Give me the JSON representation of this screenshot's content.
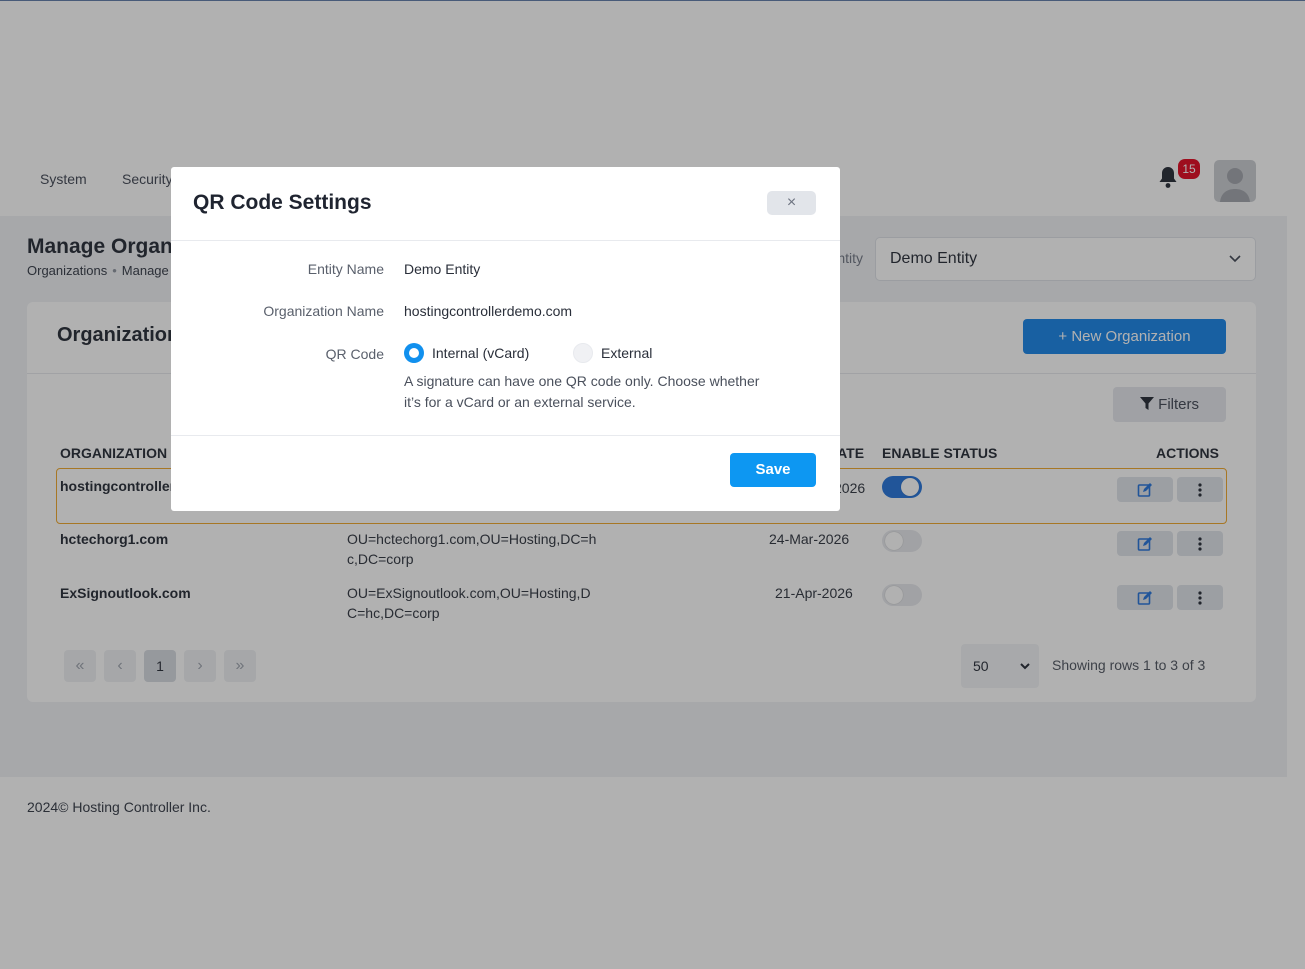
{
  "nav": {
    "items": [
      "System",
      "Security"
    ],
    "notifications": "15"
  },
  "page": {
    "title": "Manage Organizations",
    "breadcrumb": [
      "Organizations",
      "Manage"
    ],
    "entity_label": "Entity",
    "entity_selected": "Demo Entity"
  },
  "card": {
    "title": "Organizations",
    "new_button": "+ New Organization",
    "filters_button": "Filters",
    "columns": [
      "ORGANIZATION",
      "DATE",
      "ENABLE STATUS",
      "ACTIONS"
    ],
    "rows": [
      {
        "name": "hostingcontrollerdemo.com",
        "dn": "",
        "date": "2026",
        "enabled": true
      },
      {
        "name": "hctechorg1.com",
        "dn_line1": "OU=hctechorg1.com,OU=Hosting,DC=h",
        "dn_line2": "c,DC=corp",
        "date": "24-Mar-2026",
        "enabled": false
      },
      {
        "name": "ExSignoutlook.com",
        "dn_line1": "OU=ExSignoutlook.com,OU=Hosting,D",
        "dn_line2": "C=hc,DC=corp",
        "date": "21-Apr-2026",
        "enabled": false
      }
    ],
    "pagination": {
      "first": "«",
      "prev": "‹",
      "current": "1",
      "next": "›",
      "last": "»"
    },
    "per_page": "50",
    "showing": "Showing rows 1 to 3 of 3"
  },
  "footer": "2024© Hosting Controller Inc.",
  "modal": {
    "title": "QR Code Settings",
    "close": "×",
    "entity_label": "Entity Name",
    "entity_value": "Demo Entity",
    "org_label": "Organization Name",
    "org_value": "hostingcontrollerdemo.com",
    "qr_label": "QR Code",
    "option_internal": "Internal (vCard)",
    "option_external": "External",
    "selected_option": "internal",
    "help_text": "A signature can have one QR code only. Choose whether it’s for a vCard or an external service.",
    "save": "Save"
  },
  "colors": {
    "primary": "#1180e8",
    "save": "#0d97f2",
    "highlight_border": "#f0a524",
    "badge": "#e2001a"
  }
}
